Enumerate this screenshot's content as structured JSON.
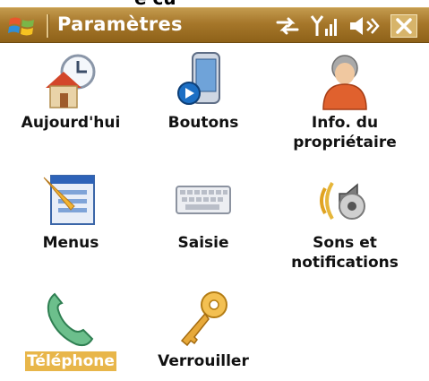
{
  "window": {
    "title": "Paramètres",
    "partial_header_text": "e cu"
  },
  "status_icons": [
    "connectivity-icon",
    "signal-icon",
    "volume-icon"
  ],
  "close_button": {
    "label": "✕"
  },
  "items": [
    {
      "label": "Aujourd'hui",
      "icon": "today-house-clock-icon"
    },
    {
      "label": "Boutons",
      "icon": "buttons-device-icon"
    },
    {
      "label": "Info. du\npropriétaire",
      "icon": "owner-info-person-icon"
    },
    {
      "label": "Menus",
      "icon": "menus-window-icon"
    },
    {
      "label": "Saisie",
      "icon": "input-keyboard-icon"
    },
    {
      "label": "Sons et\nnotifications",
      "icon": "sounds-notifications-icon"
    },
    {
      "label": "Téléphone",
      "icon": "phone-handset-icon",
      "selected": true
    },
    {
      "label": "Verrouiller",
      "icon": "lock-key-icon"
    }
  ],
  "colors": {
    "titlebar": "#a6772a",
    "selection": "#e8b64a"
  }
}
